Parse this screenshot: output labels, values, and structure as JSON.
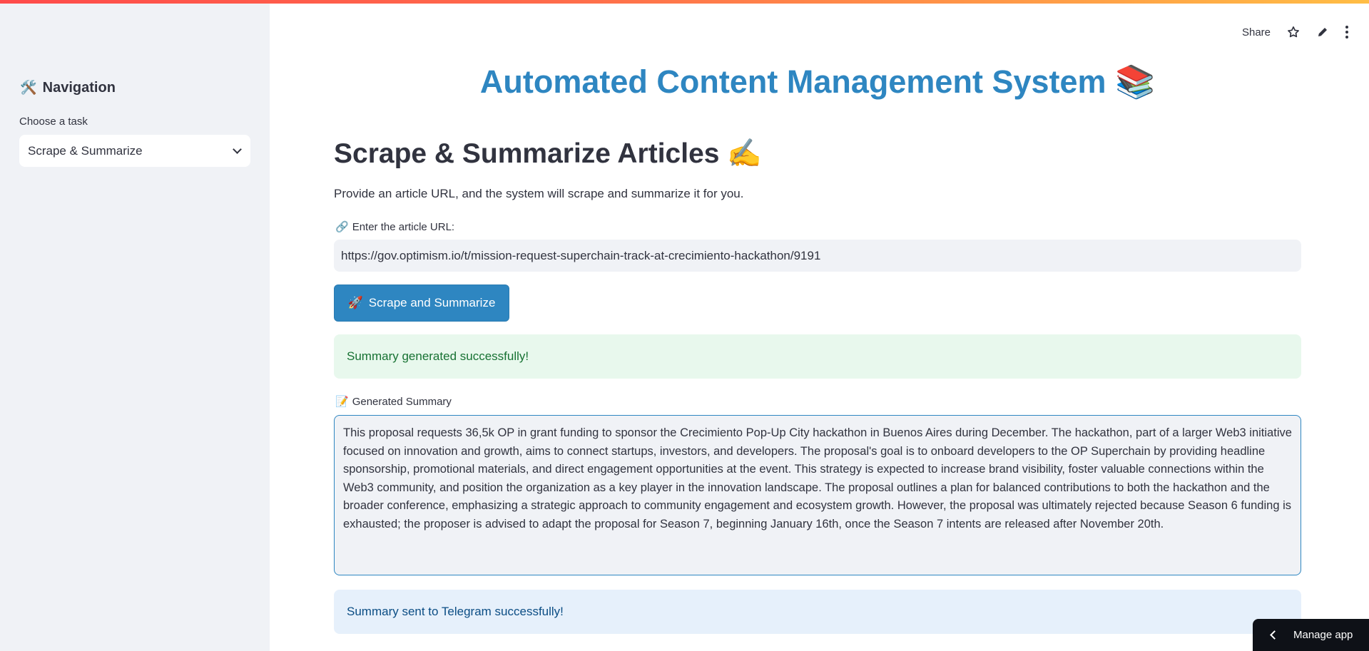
{
  "header": {
    "share_label": "Share",
    "icons": [
      "star-icon",
      "pencil-icon",
      "kebab-menu-icon"
    ]
  },
  "sidebar": {
    "title_icon": "🛠️",
    "title": "Navigation",
    "select_label": "Choose a task",
    "select_value": "Scrape & Summarize"
  },
  "main": {
    "app_title": "Automated Content Management System 📚",
    "page_heading": "Scrape & Summarize Articles ✍️",
    "intro": "Provide an article URL, and the system will scrape and summarize it for you.",
    "url_label_icon": "🔗",
    "url_label": "Enter the article URL:",
    "url_value": "https://gov.optimism.io/t/mission-request-superchain-track-at-crecimiento-hackathon/9191",
    "button_icon": "🚀",
    "button_label": "Scrape and Summarize",
    "success_message": "Summary generated successfully!",
    "summary_label_icon": "📝",
    "summary_label": "Generated Summary",
    "summary_text": "This proposal requests 36,5k OP in grant funding to sponsor the Crecimiento Pop-Up City hackathon in Buenos Aires during December.  The hackathon, part of a larger Web3 initiative focused on innovation and growth, aims to connect startups, investors, and developers.  The proposal's goal is to onboard developers to the OP Superchain by providing headline sponsorship, promotional materials, and direct engagement opportunities at the event. This strategy is expected to increase brand visibility, foster valuable connections within the Web3 community, and position the organization as a key player in the innovation landscape.  The proposal outlines a plan for balanced contributions to both the hackathon and the broader conference, emphasizing a strategic approach to community engagement and ecosystem growth. However, the proposal was ultimately rejected because Season 6 funding is exhausted;  the proposer is advised to adapt the proposal for Season 7, beginning January 16th, once the Season 7 intents are released after November 20th.",
    "telegram_message": "Summary sent to Telegram successfully!"
  },
  "footer": {
    "manage_app_label": "Manage app"
  },
  "colors": {
    "accent": "#2e86c1",
    "sidebar_bg": "#f0f2f6",
    "success_bg": "#e8f8ed",
    "info_bg": "#e6f0fb"
  }
}
